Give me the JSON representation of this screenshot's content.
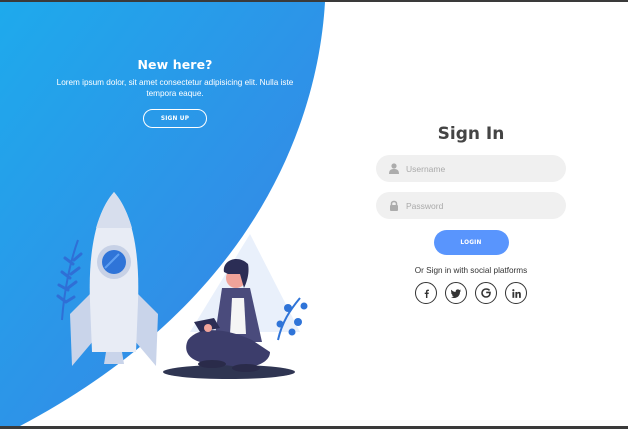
{
  "promo": {
    "title": "New here?",
    "text": "Lorem ipsum dolor, sit amet consectetur adipisicing elit. Nulla iste tempora eaque.",
    "signup_label": "SIGN UP"
  },
  "form": {
    "title": "Sign In",
    "username_placeholder": "Username",
    "password_placeholder": "Password",
    "login_label": "LOGIN",
    "social_text": "Or Sign in with social platforms"
  },
  "social": [
    {
      "icon": "facebook-icon"
    },
    {
      "icon": "twitter-icon"
    },
    {
      "icon": "google-icon"
    },
    {
      "icon": "linkedin-icon"
    }
  ],
  "colors": {
    "accent": "#5995fd",
    "panel_gradient_start": "#1fa5ea",
    "panel_gradient_end": "#3a82e6",
    "input_background": "#f0f0f0",
    "title_text": "#444444"
  }
}
